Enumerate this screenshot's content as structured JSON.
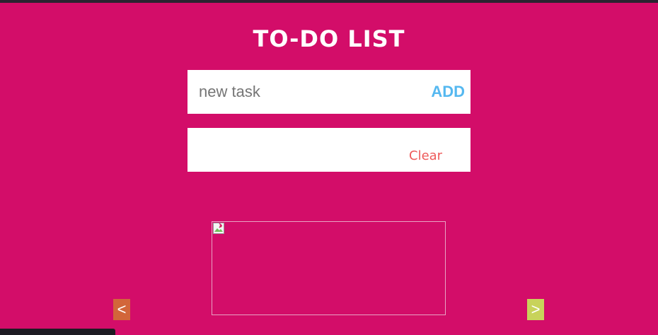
{
  "app": {
    "title": "TO-DO LIST"
  },
  "task_input": {
    "placeholder": "new task",
    "value": ""
  },
  "add_button": {
    "label": "ADD"
  },
  "task_list": {
    "items": [],
    "clear_label": "Clear"
  },
  "carousel": {
    "prev_label": "<",
    "next_label": ">",
    "image_icon": "broken-image-icon"
  },
  "colors": {
    "background": "#d30d69",
    "add_accent": "#55b8f0",
    "clear_accent": "#ee5a5a",
    "prev_button": "#d2663a",
    "next_button": "#c8d35a"
  }
}
